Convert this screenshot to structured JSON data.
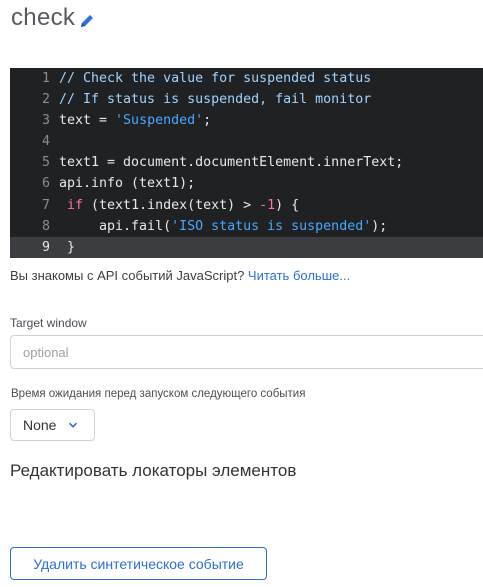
{
  "header": {
    "title": "check",
    "edit_icon": "pencil-icon"
  },
  "editor": {
    "active_line": 9,
    "lines": [
      {
        "num": "1",
        "tokens": [
          {
            "t": "comment",
            "v": "// Check the value for suspended status"
          }
        ]
      },
      {
        "num": "2",
        "tokens": [
          {
            "t": "comment",
            "v": "// If status is suspended, fail monitor"
          }
        ]
      },
      {
        "num": "3",
        "tokens": [
          {
            "t": "plain",
            "v": "text = "
          },
          {
            "t": "string",
            "v": "'Suspended'"
          },
          {
            "t": "plain",
            "v": ";"
          }
        ]
      },
      {
        "num": "4",
        "tokens": []
      },
      {
        "num": "5",
        "tokens": [
          {
            "t": "plain",
            "v": "text1 = document.documentElement.innerText;"
          }
        ]
      },
      {
        "num": "6",
        "tokens": [
          {
            "t": "plain",
            "v": "api.info (text1);"
          }
        ]
      },
      {
        "num": "7",
        "tokens": [
          {
            "t": "kw",
            "v": " if"
          },
          {
            "t": "plain",
            "v": " (text1.index(text) > "
          },
          {
            "t": "number",
            "v": "-1"
          },
          {
            "t": "plain",
            "v": ") {"
          }
        ]
      },
      {
        "num": "8",
        "tokens": [
          {
            "t": "plain",
            "v": "     api.fail("
          },
          {
            "t": "string",
            "v": "'ISO status is suspended'"
          },
          {
            "t": "plain",
            "v": ");"
          }
        ]
      },
      {
        "num": "9",
        "tokens": [
          {
            "t": "plain",
            "v": " }"
          }
        ]
      }
    ]
  },
  "help": {
    "text": "Вы знакомы с API событий JavaScript? ",
    "link": "Читать больше..."
  },
  "target_window": {
    "label": "Target window",
    "placeholder": "optional",
    "value": ""
  },
  "wait": {
    "label": "Время ожидания перед запуском следующего события",
    "selected": "None",
    "icon": "chevron-down-icon"
  },
  "locators": {
    "heading": "Редактировать локаторы элементов"
  },
  "delete_button": {
    "label": "Удалить синтетическое событие"
  },
  "colors": {
    "accent": "#2c6fd6",
    "editor_bg": "#1f2123",
    "comment": "#9fd3ff",
    "string": "#4aa8ff",
    "keyword": "#ff6fae"
  }
}
